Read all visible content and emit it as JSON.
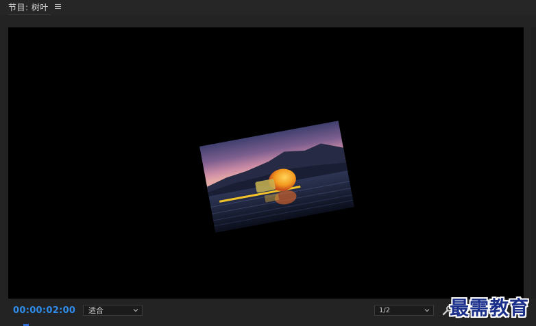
{
  "panel": {
    "title": "节目: 树叶",
    "menu_icon": "hamburger-menu-icon"
  },
  "controls": {
    "timecode": "00:00:02:00",
    "zoom_value": "适合",
    "resolution_value": "1/2",
    "settings_icon": "wrench-icon"
  },
  "watermark": {
    "text": "最需教育"
  },
  "colors": {
    "timecode": "#2d8ceb",
    "panel_bg": "#232323",
    "monitor_bg": "#000000",
    "watermark": "#1a2f8a"
  }
}
